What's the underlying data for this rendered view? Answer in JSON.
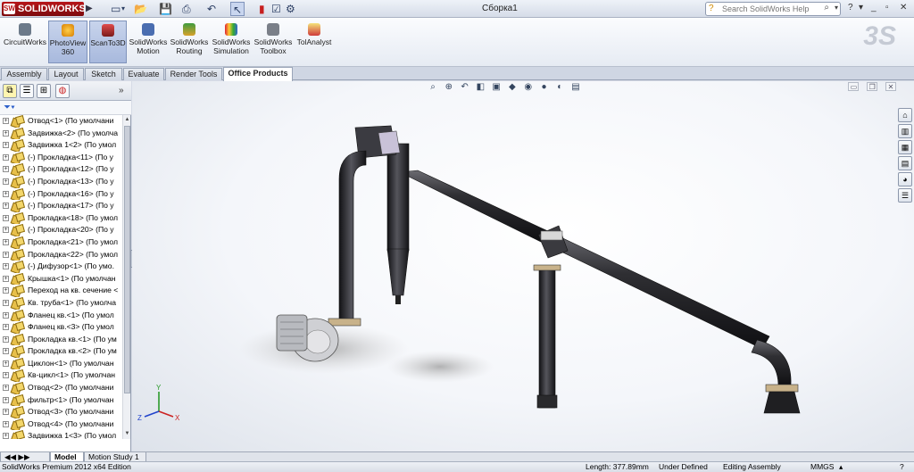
{
  "titlebar": {
    "app_name": "SOLIDWORKS",
    "document_title": "Сборка1",
    "help_search_placeholder": "Search SolidWorks Help"
  },
  "command_manager": {
    "items": [
      {
        "label": "CircuitWorks",
        "icon": "circuitworks-icon"
      },
      {
        "label": "PhotoView\n360",
        "icon": "photoview-icon",
        "active": true
      },
      {
        "label": "ScanTo3D",
        "icon": "scanto3d-icon",
        "active": true
      },
      {
        "label": "SolidWorks\nMotion",
        "icon": "motion-icon"
      },
      {
        "label": "SolidWorks\nRouting",
        "icon": "routing-icon"
      },
      {
        "label": "SolidWorks\nSimulation",
        "icon": "simulation-icon"
      },
      {
        "label": "SolidWorks\nToolbox",
        "icon": "toolbox-icon"
      },
      {
        "label": "TolAnalyst",
        "icon": "tolanalyst-icon"
      }
    ]
  },
  "tabs": [
    {
      "label": "Assembly"
    },
    {
      "label": "Layout"
    },
    {
      "label": "Sketch"
    },
    {
      "label": "Evaluate"
    },
    {
      "label": "Render Tools"
    },
    {
      "label": "Office Products",
      "active": true
    }
  ],
  "feature_tree": {
    "items": [
      "Отвод<1> (По умолчани",
      "Задвижка<2> (По умолча",
      "Задвижка 1<2> (По умол",
      "(-) Прокладка<11> (По у",
      "(-) Прокладка<12> (По у",
      "(-) Прокладка<13> (По у",
      "(-) Прокладка<16> (По у",
      "(-) Прокладка<17> (По у",
      "Прокладка<18> (По умол",
      "(-) Прокладка<20> (По у",
      "Прокладка<21> (По умол",
      "Прокладка<22> (По умол",
      "(-) Дифузор<1> (По умо.",
      "Крышка<1> (По умолчан",
      "Переход на кв. сечение <",
      "Кв. труба<1> (По умолча",
      "Фланец кв.<1> (По умол",
      "Фланец кв.<3> (По умол",
      "Прокладка кв.<1> (По ум",
      "Прокладка кв.<2> (По ум",
      "Циклон<1> (По умолчан",
      "Кв-цикл<1> (По умолчан",
      "Отвод<2> (По умолчани",
      "фильтр<1> (По умолчан",
      "Отвод<3> (По умолчани",
      "Отвод<4> (По умолчани",
      "Задвижка 1<3> (По умол"
    ]
  },
  "bottom_tabs": [
    {
      "label": "Model",
      "active": true
    },
    {
      "label": "Motion Study 1"
    }
  ],
  "statusbar": {
    "edition": "SolidWorks Premium 2012 x64 Edition",
    "length": "Length: 377.89mm",
    "state": "Under Defined",
    "mode": "Editing Assembly",
    "units": "MMGS"
  },
  "triad": {
    "x": "X",
    "y": "Y",
    "z": "Z"
  },
  "colors": {
    "accent": "#b8161a",
    "model_metal": "#2b2b2e",
    "flange": "#c8b28a"
  }
}
